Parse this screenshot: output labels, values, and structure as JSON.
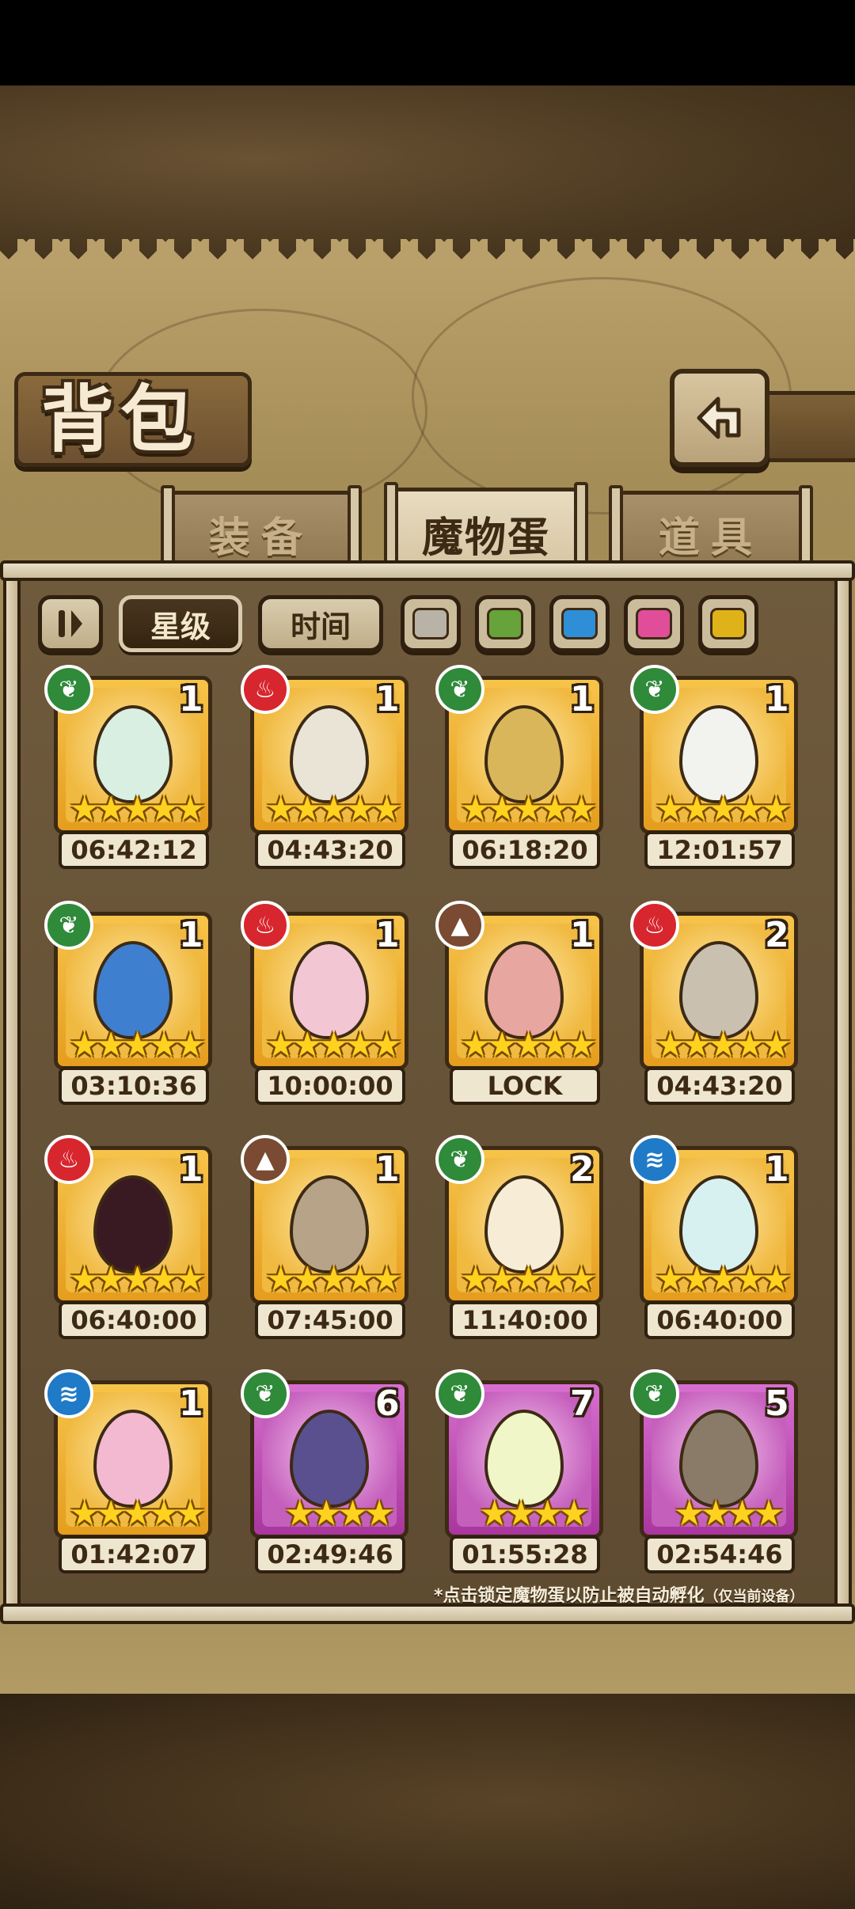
{
  "header": {
    "title": "背包"
  },
  "tabs": [
    {
      "label": "装备",
      "active": false
    },
    {
      "label": "魔物蛋",
      "active": true
    },
    {
      "label": "道具",
      "active": false
    }
  ],
  "filters": {
    "sort_stars": "星级",
    "sort_time": "时间",
    "swatches": [
      {
        "name": "gray",
        "color": "#b8b3a6"
      },
      {
        "name": "green",
        "color": "#66a33a"
      },
      {
        "name": "blue",
        "color": "#2f8fd6"
      },
      {
        "name": "pink",
        "color": "#e04e9a"
      },
      {
        "name": "yellow",
        "color": "#e0b21a"
      }
    ]
  },
  "eggs": [
    {
      "element": "grass",
      "count": "1",
      "stars": "★★★★★",
      "timer": "06:42:12",
      "rarity": "gold",
      "egg_color": "#d9efe2"
    },
    {
      "element": "fire",
      "count": "1",
      "stars": "★★★★★",
      "timer": "04:43:20",
      "rarity": "gold",
      "egg_color": "#e9e4d6"
    },
    {
      "element": "grass",
      "count": "1",
      "stars": "★★★★★",
      "timer": "06:18:20",
      "rarity": "gold",
      "egg_color": "#d9b65a"
    },
    {
      "element": "grass",
      "count": "1",
      "stars": "★★★★★",
      "timer": "12:01:57",
      "rarity": "gold",
      "egg_color": "#f2f2ee"
    },
    {
      "element": "grass",
      "count": "1",
      "stars": "★★★★★",
      "timer": "03:10:36",
      "rarity": "gold",
      "egg_color": "#3f7fd0"
    },
    {
      "element": "fire",
      "count": "1",
      "stars": "★★★★★",
      "timer": "10:00:00",
      "rarity": "gold",
      "egg_color": "#f3c6d4"
    },
    {
      "element": "earth",
      "count": "1",
      "stars": "★★★★★",
      "timer": "LOCK",
      "rarity": "gold",
      "egg_color": "#e8a6a0"
    },
    {
      "element": "fire",
      "count": "2",
      "stars": "★★★★★",
      "timer": "04:43:20",
      "rarity": "gold",
      "egg_color": "#c9c0b0"
    },
    {
      "element": "fire",
      "count": "1",
      "stars": "★★★★★",
      "timer": "06:40:00",
      "rarity": "gold",
      "egg_color": "#3a1a22"
    },
    {
      "element": "earth",
      "count": "1",
      "stars": "★★★★★",
      "timer": "07:45:00",
      "rarity": "gold",
      "egg_color": "#b7a488"
    },
    {
      "element": "grass",
      "count": "2",
      "stars": "★★★★★",
      "timer": "11:40:00",
      "rarity": "gold",
      "egg_color": "#f7edd6"
    },
    {
      "element": "water",
      "count": "1",
      "stars": "★★★★★",
      "timer": "06:40:00",
      "rarity": "gold",
      "egg_color": "#d7f1f0"
    },
    {
      "element": "water",
      "count": "1",
      "stars": "★★★★★",
      "timer": "01:42:07",
      "rarity": "gold",
      "egg_color": "#f3b9d0"
    },
    {
      "element": "grass",
      "count": "6",
      "stars": "★★★★",
      "timer": "02:49:46",
      "rarity": "purple",
      "egg_color": "#5a4f8f"
    },
    {
      "element": "grass",
      "count": "7",
      "stars": "★★★★",
      "timer": "01:55:28",
      "rarity": "purple",
      "egg_color": "#f0f6c8"
    },
    {
      "element": "grass",
      "count": "5",
      "stars": "★★★★",
      "timer": "02:54:46",
      "rarity": "purple",
      "egg_color": "#8a7a68"
    }
  ],
  "element_colors": {
    "grass": "#2f8a3a",
    "fire": "#d8262e",
    "earth": "#7a4a32",
    "water": "#1f7ac8"
  },
  "element_icons": {
    "grass": "leaf-icon",
    "fire": "flame-icon",
    "earth": "mountain-icon",
    "water": "waves-icon"
  },
  "footer_note": {
    "main": "*点击锁定魔物蛋以防止被自动孵化",
    "suffix": "（仅当前设备）"
  }
}
